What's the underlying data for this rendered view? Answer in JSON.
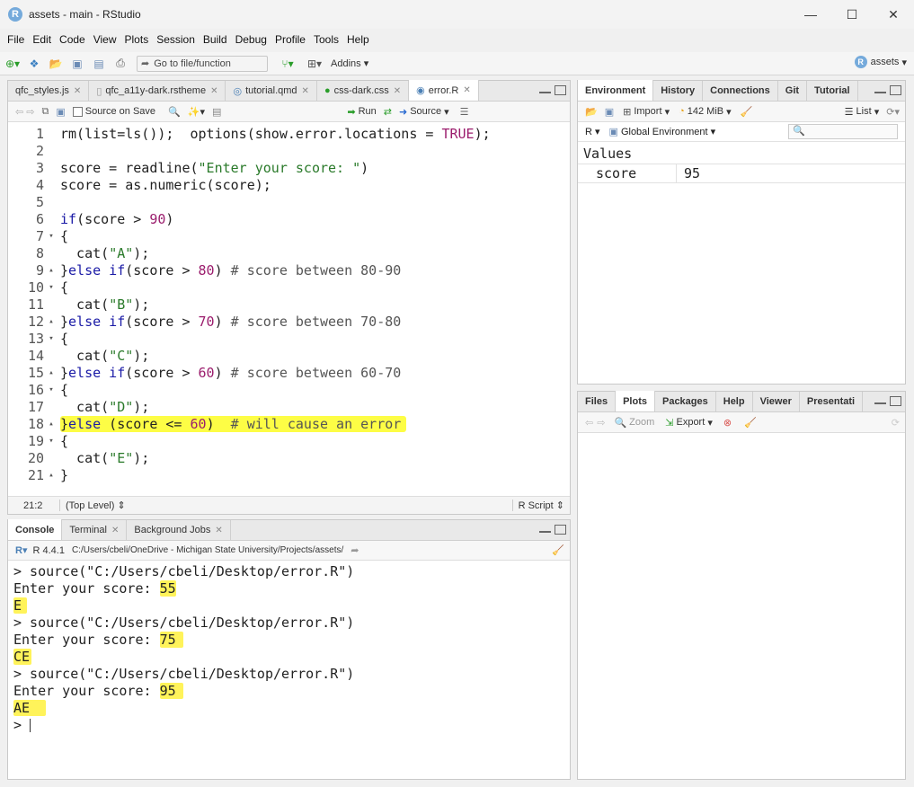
{
  "window": {
    "title": "assets - main - RStudio",
    "min": "—",
    "max": "☐",
    "close": "✕"
  },
  "menu": [
    "File",
    "Edit",
    "Code",
    "View",
    "Plots",
    "Session",
    "Build",
    "Debug",
    "Profile",
    "Tools",
    "Help"
  ],
  "toolbar": {
    "goto_placeholder": "Go to file/function",
    "addins": "Addins",
    "project": "assets"
  },
  "editor": {
    "tabs": [
      "qfc_styles.js",
      "qfc_a11y-dark.rstheme",
      "tutorial.qmd",
      "css-dark.css",
      "error.R"
    ],
    "active_tab": "error.R",
    "source_on_save": "Source on Save",
    "run": "Run",
    "source": "Source",
    "status_pos": "21:2",
    "status_scope": "(Top Level)",
    "status_type": "R Script"
  },
  "code_lines": [
    {
      "n": "1",
      "fold": ""
    },
    {
      "n": "2",
      "fold": ""
    },
    {
      "n": "3",
      "fold": ""
    },
    {
      "n": "4",
      "fold": ""
    },
    {
      "n": "5",
      "fold": ""
    },
    {
      "n": "6",
      "fold": ""
    },
    {
      "n": "7",
      "fold": "▾"
    },
    {
      "n": "8",
      "fold": ""
    },
    {
      "n": "9",
      "fold": "▴"
    },
    {
      "n": "10",
      "fold": "▾"
    },
    {
      "n": "11",
      "fold": ""
    },
    {
      "n": "12",
      "fold": "▴"
    },
    {
      "n": "13",
      "fold": "▾"
    },
    {
      "n": "14",
      "fold": ""
    },
    {
      "n": "15",
      "fold": "▴"
    },
    {
      "n": "16",
      "fold": "▾"
    },
    {
      "n": "17",
      "fold": ""
    },
    {
      "n": "18",
      "fold": "▴"
    },
    {
      "n": "19",
      "fold": "▾"
    },
    {
      "n": "20",
      "fold": ""
    },
    {
      "n": "21",
      "fold": "▴"
    }
  ],
  "code": {
    "l1a": "rm(list=ls());  options(show.error.locations = ",
    "l1b": "TRUE",
    "l1c": ");",
    "l3a": "score = readline(",
    "l3b": "\"Enter your score: \"",
    "l3c": ")",
    "l4": "score = as.numeric(score);",
    "l6a": "if",
    "l6b": "(score > ",
    "l6c": "90",
    "l6d": ")",
    "l7": "{",
    "l8a": "  cat(",
    "l8b": "\"A\"",
    "l8c": ");",
    "l9a": "}",
    "l9b": "else if",
    "l9c": "(score > ",
    "l9d": "80",
    "l9e": ") ",
    "l9f": "# score between 80-90",
    "l10": "{",
    "l11a": "  cat(",
    "l11b": "\"B\"",
    "l11c": ");",
    "l12a": "}",
    "l12b": "else if",
    "l12c": "(score > ",
    "l12d": "70",
    "l12e": ") ",
    "l12f": "# score between 70-80",
    "l13": "{",
    "l14a": "  cat(",
    "l14b": "\"C\"",
    "l14c": ");",
    "l15a": "}",
    "l15b": "else if",
    "l15c": "(score > ",
    "l15d": "60",
    "l15e": ") ",
    "l15f": "# score between 60-70",
    "l16": "{",
    "l17a": "  cat(",
    "l17b": "\"D\"",
    "l17c": ");",
    "l18a": "}",
    "l18b": "else",
    "l18c": " (score <= ",
    "l18d": "60",
    "l18e": ")  ",
    "l18f": "# will cause an error",
    "l19": "{",
    "l20a": "  cat(",
    "l20b": "\"E\"",
    "l20c": ");",
    "l21": "}"
  },
  "console": {
    "tabs": [
      "Console",
      "Terminal",
      "Background Jobs"
    ],
    "r_version": "R 4.4.1",
    "path": "C:/Users/cbeli/OneDrive - Michigan State University/Projects/assets/",
    "src": "> source(\"C:/Users/cbeli/Desktop/error.R\")",
    "prompt_text": "Enter your score: ",
    "in1": "55",
    "out1": "E",
    "in2": "75",
    "out2": "CE",
    "in3": "95",
    "out3": "AE",
    "final_prompt": "> "
  },
  "environment": {
    "tabs": [
      "Environment",
      "History",
      "Connections",
      "Git",
      "Tutorial"
    ],
    "import": "Import",
    "memory": "142 MiB",
    "list": "List",
    "lang": "R",
    "scope": "Global Environment",
    "section": "Values",
    "var_name": "score",
    "var_value": "95"
  },
  "files": {
    "tabs": [
      "Files",
      "Plots",
      "Packages",
      "Help",
      "Viewer",
      "Presentati"
    ],
    "zoom": "Zoom",
    "export": "Export"
  }
}
